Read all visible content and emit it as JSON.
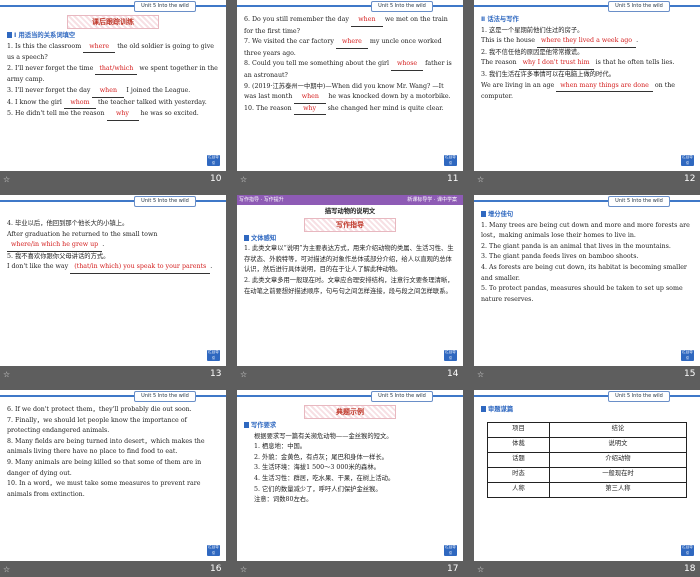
{
  "unit_label": "Unit 5  Into the wild",
  "back_label": "栏目导引",
  "slides": [
    {
      "page": "10",
      "banner": "课后跟踪训练",
      "section": "Ⅰ 用适当的关系词填空",
      "lines": [
        {
          "pre": "1. Is this the classroom ",
          "ans": "where",
          "post": " the old soldier is going to give us a speech?"
        },
        {
          "pre": "2. I'll never forget the time ",
          "ans": "that/which",
          "post": " we spent together in the army camp."
        },
        {
          "pre": "3. I'll never forget the day ",
          "ans": "when",
          "post": " I joined the League."
        },
        {
          "pre": "4. I know the girl ",
          "ans": "whom",
          "post": " the teacher talked with yesterday."
        },
        {
          "pre": "5. He didn't tell me the reason ",
          "ans": "why",
          "post": " he was so excited."
        }
      ]
    },
    {
      "page": "11",
      "lines": [
        {
          "pre": "6. Do you still remember the day ",
          "ans": "when",
          "post": " we met on the train for the first time?"
        },
        {
          "pre": "7. We visited the car factory ",
          "ans": "where",
          "post": " my uncle once worked three years ago."
        },
        {
          "pre": "8. Could you tell me something about the girl ",
          "ans": "whose",
          "post": " father is an astronaut?"
        },
        {
          "pre": "9. (2019·江苏泰州一中期中)—When did you know Mr. Wang? —It was last month ",
          "ans": "when",
          "post": " he was knocked down by a motorbike."
        },
        {
          "pre": "10. The reason ",
          "ans": "why",
          "post": " she changed her mind is quite clear."
        }
      ]
    },
    {
      "page": "12",
      "section": "Ⅱ 话法与写作",
      "lines": [
        {
          "pre": "1. 这是一个星期前他们住过的房子。",
          "ans": "",
          "post": ""
        },
        {
          "pre": "This is the house ",
          "ans": "where they lived a week ago",
          "post": "."
        },
        {
          "pre": "2. 我不信任他的原因是他常常撒谎。",
          "ans": "",
          "post": ""
        },
        {
          "pre": "The reason ",
          "ans": "why I don't trust him",
          "post": " is that he often tells lies."
        },
        {
          "pre": "3. 我们生活在许多事情可以在电脑上做的时代。",
          "ans": "",
          "post": ""
        },
        {
          "pre": "We are living in an age ",
          "ans": "when many things are done",
          "post": " on the computer."
        }
      ]
    },
    {
      "page": "13",
      "lines": [
        {
          "pre": "4. 毕业以后，他回到那个他长大的小镇上。",
          "ans": "",
          "post": ""
        },
        {
          "pre": "After graduation he returned to the small town ",
          "ans": "where/in which he grew up",
          "post": "."
        },
        {
          "pre": "5. 我不喜欢你跟你父母讲话的方式。",
          "ans": "",
          "post": ""
        },
        {
          "pre": "I don't like the way ",
          "ans": "(that/in which) you speak to your parents",
          "post": "."
        }
      ]
    },
    {
      "page": "14",
      "purple_left": "写作指导 · 写作提升",
      "purple_right": "新课标导学 · 课中学案",
      "heading": "描写动物的说明文",
      "banner": "写作指导",
      "section": "文体感知",
      "paras": [
        "1. 此类文章以“说明”为主要表达方式，用来介绍动物的类属、生活习性、生存状态、外貌特等，可对描述的对象作总体或部分介绍，给人以直观的总体认识，然后进行具体说明，目的在于让人了解此种动物。",
        "2. 此类文章多用一般现在时。文章应合理安排结构，注意行文要条理清晰，在动笔之前要想好描述顺序，句与句之间怎样连接，段与段之间怎样联系。"
      ]
    },
    {
      "page": "15",
      "section": "增分佳句",
      "paras": [
        "1. Many trees are being cut down and more and more forests are lost，making animals lose their homes to live in.",
        "2. The giant panda is an animal that lives in the mountains.",
        "3. The giant panda feeds lives on bamboo shoots.",
        "4. As forests are being cut down, its habitat is becoming smaller and smaller.",
        "5. To protect pandas, measures should be taken to set up some nature reserves."
      ]
    },
    {
      "page": "16",
      "paras": [
        "6. If we don't protect them，they'll probably die out soon.",
        "7. Finally，we should let people know the importance of protecting endangered animals.",
        "8. Many fields are being turned into desert，which makes the animals living there have no place to find food to eat.",
        "9. Many animals are being killed so that some of them are in danger of dying out.",
        "10. In a word，we must take some measures to prevent rare animals from extinction."
      ]
    },
    {
      "page": "17",
      "banner": "典题示例",
      "section": "写作要求",
      "paras": [
        "根据要求写一篇有关濒危动物——金丝猴的短文。",
        "1. 栖息地：中国。",
        "2. 外貌：金黄色，有点灰；尾巴和身体一样长。",
        "3. 生活环境：海拔1 500～3 000米的森林。",
        "4. 生活习性：群居，吃水果、干果，在树上活动。",
        "5. 它们的数量减少了，呼吁人们保护金丝猴。",
        "注意：词数80左右。"
      ]
    },
    {
      "page": "18",
      "section": "审题谋篇",
      "table": [
        [
          "项目",
          "结论"
        ],
        [
          "体裁",
          "说明文"
        ],
        [
          "话题",
          "介绍动物"
        ],
        [
          "时态",
          "一般现在时"
        ],
        [
          "人称",
          "第三人称"
        ]
      ]
    }
  ]
}
